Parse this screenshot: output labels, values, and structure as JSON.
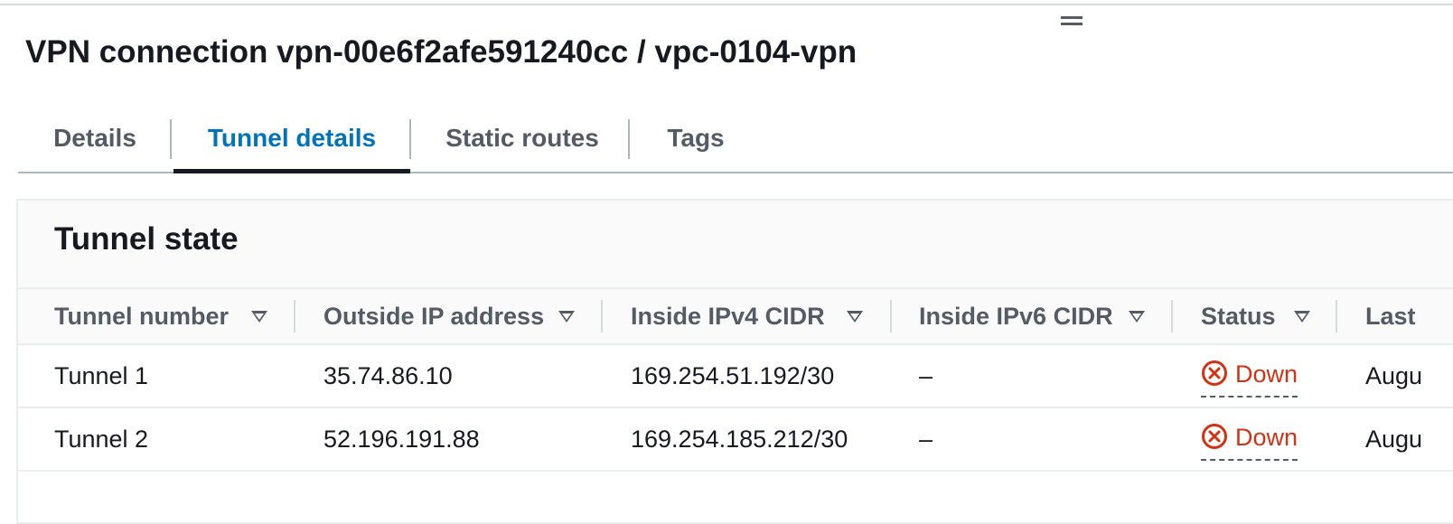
{
  "page": {
    "title": "VPN connection vpn-00e6f2afe591240cc / vpc-0104-vpn"
  },
  "tabs": [
    {
      "label": "Details"
    },
    {
      "label": "Tunnel details"
    },
    {
      "label": "Static routes"
    },
    {
      "label": "Tags"
    }
  ],
  "active_tab": "Tunnel details",
  "tunnel_state": {
    "title": "Tunnel state",
    "columns": [
      {
        "label": "Tunnel number"
      },
      {
        "label": "Outside IP address"
      },
      {
        "label": "Inside IPv4 CIDR"
      },
      {
        "label": "Inside IPv6 CIDR"
      },
      {
        "label": "Status"
      },
      {
        "label": "Last"
      }
    ],
    "rows": [
      {
        "tunnel_number": "Tunnel 1",
        "outside_ip": "35.74.86.10",
        "inside_ipv4": "169.254.51.192/30",
        "inside_ipv6": "–",
        "status": "Down",
        "last": "Augu"
      },
      {
        "tunnel_number": "Tunnel 2",
        "outside_ip": "52.196.191.88",
        "inside_ipv4": "169.254.185.212/30",
        "inside_ipv6": "–",
        "status": "Down",
        "last": "Augu"
      }
    ]
  },
  "icons": {
    "drag_handle": "drag-handle-icon",
    "filter": "caret-down-icon",
    "status_down": "x-circle-icon"
  },
  "colors": {
    "active_tab": "#0073bb",
    "status_down": "#d13212",
    "text": "#16191f",
    "muted": "#545b64"
  }
}
